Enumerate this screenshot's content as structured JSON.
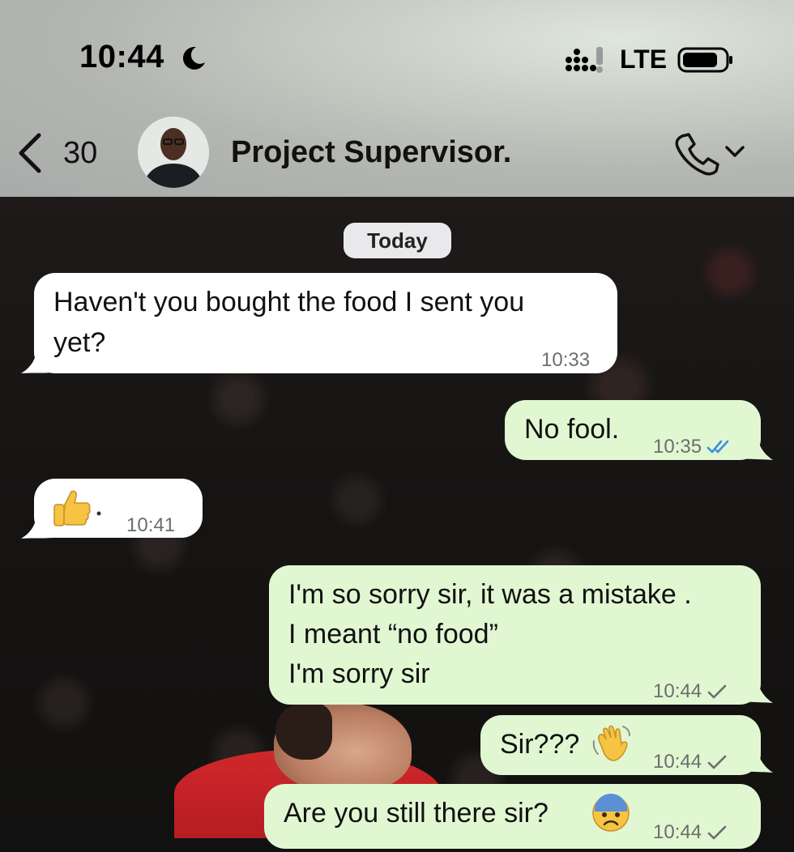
{
  "status_bar": {
    "time": "10:44",
    "network": "LTE"
  },
  "header": {
    "back_count": "30",
    "contact_name": "Project Supervisor."
  },
  "chat": {
    "date_label": "Today",
    "messages": [
      {
        "direction": "incoming",
        "lines": [
          "Haven't you bought the food I sent you",
          "yet?"
        ],
        "time": "10:33"
      },
      {
        "direction": "outgoing",
        "text": "No fool.",
        "time": "10:35",
        "status": "read"
      },
      {
        "direction": "incoming",
        "emoji": "thumbs-up",
        "time": "10:41"
      },
      {
        "direction": "outgoing",
        "lines": [
          "I'm so sorry sir, it was a mistake .",
          "I meant “no food”",
          "I'm sorry sir"
        ],
        "time": "10:44",
        "status": "sent"
      },
      {
        "direction": "outgoing",
        "text": "Sir???",
        "emoji": "waving-hand",
        "time": "10:44",
        "status": "sent"
      },
      {
        "direction": "outgoing",
        "text": "Are you still there sir?",
        "emoji": "anxious-face-with-sweat",
        "time": "10:44",
        "status": "sent"
      }
    ]
  },
  "colors": {
    "incoming_bubble": "#ffffff",
    "outgoing_bubble": "#e1f7d2",
    "read_tick": "#3a8ee6",
    "timestamp": "#6d6d6d"
  }
}
